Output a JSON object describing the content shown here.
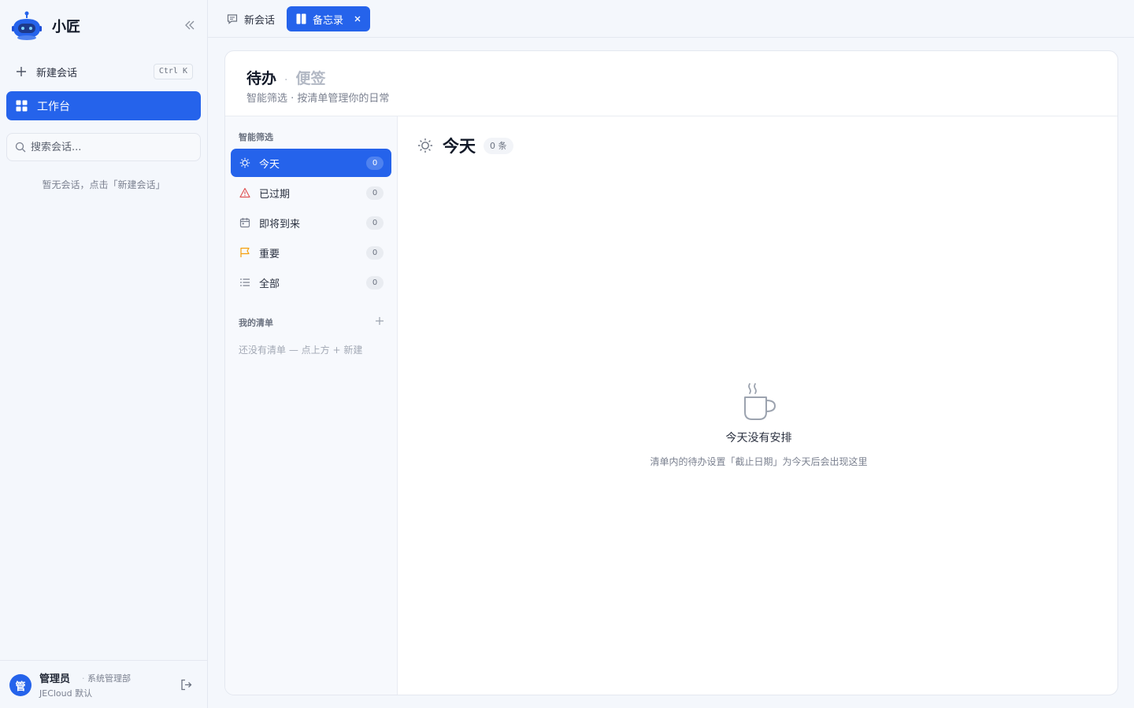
{
  "app": {
    "name": "小匠"
  },
  "sidebar": {
    "new_chat_label": "新建会话",
    "new_chat_shortcut": "Ctrl K",
    "workbench_label": "工作台",
    "search_placeholder": "搜索会话...",
    "empty_hint": "暂无会话，点击「新建会话」"
  },
  "user": {
    "avatar_text": "管",
    "name": "管理员",
    "department": "系统管理部",
    "org": "JECloud 默认"
  },
  "tabs": [
    {
      "label": "新会话",
      "icon": "chat-bubble-icon",
      "active": false
    },
    {
      "label": "备忘录",
      "icon": "notebook-icon",
      "active": true
    }
  ],
  "page": {
    "title_active": "待办",
    "title_separator": "·",
    "title_inactive": "便签",
    "subtitle": "智能筛选 · 按清单管理你的日常"
  },
  "filters": {
    "section_label": "智能筛选",
    "items": [
      {
        "label": "今天",
        "count": "0",
        "icon": "sun-icon",
        "active": true
      },
      {
        "label": "已过期",
        "count": "0",
        "icon": "warning-icon",
        "active": false
      },
      {
        "label": "即将到来",
        "count": "0",
        "icon": "calendar-icon",
        "active": false
      },
      {
        "label": "重要",
        "count": "0",
        "icon": "flag-icon",
        "active": false
      },
      {
        "label": "全部",
        "count": "0",
        "icon": "list-icon",
        "active": false
      }
    ]
  },
  "my_lists": {
    "section_label": "我的清单",
    "empty_text": "还没有清单 — 点上方 + 新建"
  },
  "content": {
    "title": "今天",
    "count_label": "0 条",
    "empty_title": "今天没有安排",
    "empty_desc": "清单内的待办设置「截止日期」为今天后会出现这里"
  },
  "colors": {
    "accent": "#2563eb",
    "warning": "#e05555",
    "flag": "#f59e0b",
    "sidebar_bg": "#f4f7fc"
  }
}
